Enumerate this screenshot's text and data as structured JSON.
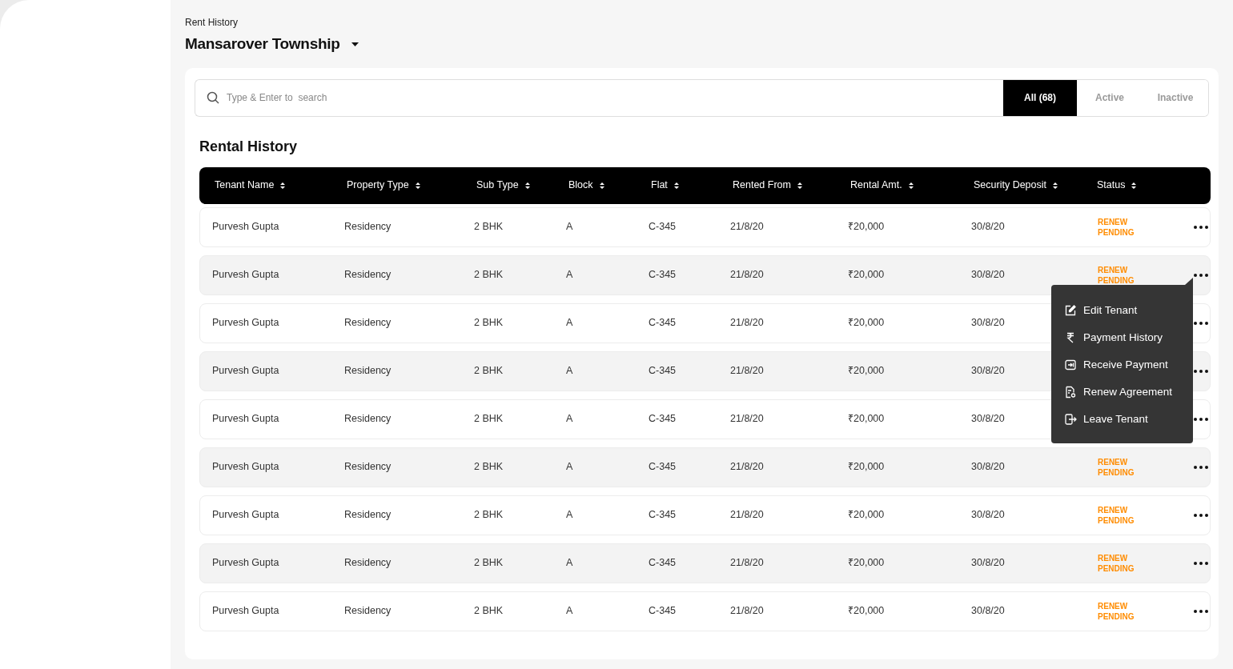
{
  "header": {
    "breadcrumb": "Rent History",
    "title": "Mansarover Township"
  },
  "search": {
    "placeholder": "Type & Enter to  search"
  },
  "filters": [
    {
      "label": "All (68)",
      "selected": true
    },
    {
      "label": "Active",
      "selected": false
    },
    {
      "label": "Inactive",
      "selected": false
    }
  ],
  "section_title": "Rental History",
  "table": {
    "columns": [
      "Tenant Name",
      "Property Type",
      "Sub Type",
      "Block",
      "Flat",
      "Rented From",
      "Rental Amt.",
      "Security Deposit",
      "Status"
    ],
    "rows": [
      {
        "cells": [
          "Purvesh Gupta",
          "Residency",
          "2 BHK",
          "A",
          "C-345",
          "21/8/20",
          "₹20,000",
          "30/8/20"
        ],
        "status": [
          "RENEW",
          "PENDING"
        ],
        "menu_open": false
      },
      {
        "cells": [
          "Purvesh Gupta",
          "Residency",
          "2 BHK",
          "A",
          "C-345",
          "21/8/20",
          "₹20,000",
          "30/8/20"
        ],
        "status": [
          "RENEW",
          "PENDING"
        ],
        "menu_open": true
      },
      {
        "cells": [
          "Purvesh Gupta",
          "Residency",
          "2 BHK",
          "A",
          "C-345",
          "21/8/20",
          "₹20,000",
          "30/8/20"
        ],
        "menu_open": false
      },
      {
        "cells": [
          "Purvesh Gupta",
          "Residency",
          "2 BHK",
          "A",
          "C-345",
          "21/8/20",
          "₹20,000",
          "30/8/20"
        ],
        "menu_open": false
      },
      {
        "cells": [
          "Purvesh Gupta",
          "Residency",
          "2 BHK",
          "A",
          "C-345",
          "21/8/20",
          "₹20,000",
          "30/8/20"
        ],
        "menu_open": false
      },
      {
        "cells": [
          "Purvesh Gupta",
          "Residency",
          "2 BHK",
          "A",
          "C-345",
          "21/8/20",
          "₹20,000",
          "30/8/20"
        ],
        "status": [
          "RENEW",
          "PENDING"
        ],
        "menu_open": false
      },
      {
        "cells": [
          "Purvesh Gupta",
          "Residency",
          "2 BHK",
          "A",
          "C-345",
          "21/8/20",
          "₹20,000",
          "30/8/20"
        ],
        "status": [
          "RENEW",
          "PENDING"
        ],
        "menu_open": false
      },
      {
        "cells": [
          "Purvesh Gupta",
          "Residency",
          "2 BHK",
          "A",
          "C-345",
          "21/8/20",
          "₹20,000",
          "30/8/20"
        ],
        "status": [
          "RENEW",
          "PENDING"
        ],
        "menu_open": false
      },
      {
        "cells": [
          "Purvesh Gupta",
          "Residency",
          "2 BHK",
          "A",
          "C-345",
          "21/8/20",
          "₹20,000",
          "30/8/20"
        ],
        "status": [
          "RENEW",
          "PENDING"
        ],
        "menu_open": false
      }
    ]
  },
  "row_menu": [
    {
      "kind": "edit",
      "label": "Edit Tenant"
    },
    {
      "kind": "rupee",
      "label": "Payment History"
    },
    {
      "kind": "receive",
      "label": "Receive Payment"
    },
    {
      "kind": "renew",
      "label": "Renew Agreement"
    },
    {
      "kind": "leave",
      "label": "Leave Tenant"
    }
  ]
}
